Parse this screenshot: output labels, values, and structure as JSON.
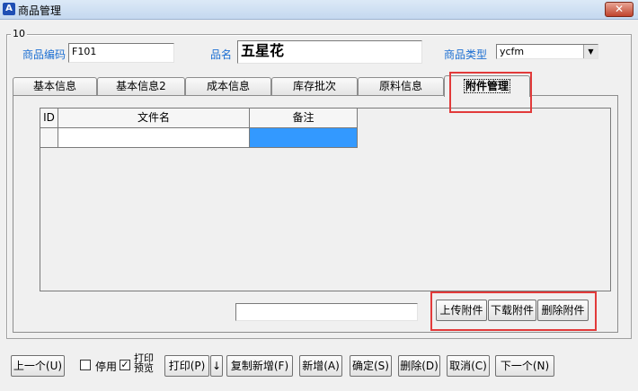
{
  "window": {
    "title": "商品管理",
    "app_icon_glyph": "A",
    "close_glyph": "✕"
  },
  "group": {
    "title": "10"
  },
  "form": {
    "code_label": "商品编码",
    "code_value": "F101",
    "name_label": "品名",
    "name_value": "五星花",
    "type_label": "商品类型",
    "type_value": "ycfm",
    "type_arrow": "▼"
  },
  "tabs": [
    {
      "label": "基本信息"
    },
    {
      "label": "基本信息2"
    },
    {
      "label": "成本信息"
    },
    {
      "label": "库存批次"
    },
    {
      "label": "原料信息"
    },
    {
      "label": "附件管理"
    }
  ],
  "grid": {
    "columns": [
      "ID",
      "文件名",
      "备注"
    ]
  },
  "attachment_buttons": {
    "upload": "上传附件",
    "download": "下载附件",
    "delete": "删除附件"
  },
  "bottom": {
    "prev": "上一个(U)",
    "disable_label": "停用",
    "disable_checked": false,
    "print_preview_line1": "打印",
    "print_preview_line2": "预览",
    "print_preview_checked": true,
    "check_glyph": "✓",
    "print": "打印(P)",
    "print_arrow": "↓",
    "copy_new": "复制新增(F)",
    "new": "新增(A)",
    "confirm": "确定(S)",
    "delete": "删除(D)",
    "cancel": "取消(C)",
    "next": "下一个(N)"
  }
}
